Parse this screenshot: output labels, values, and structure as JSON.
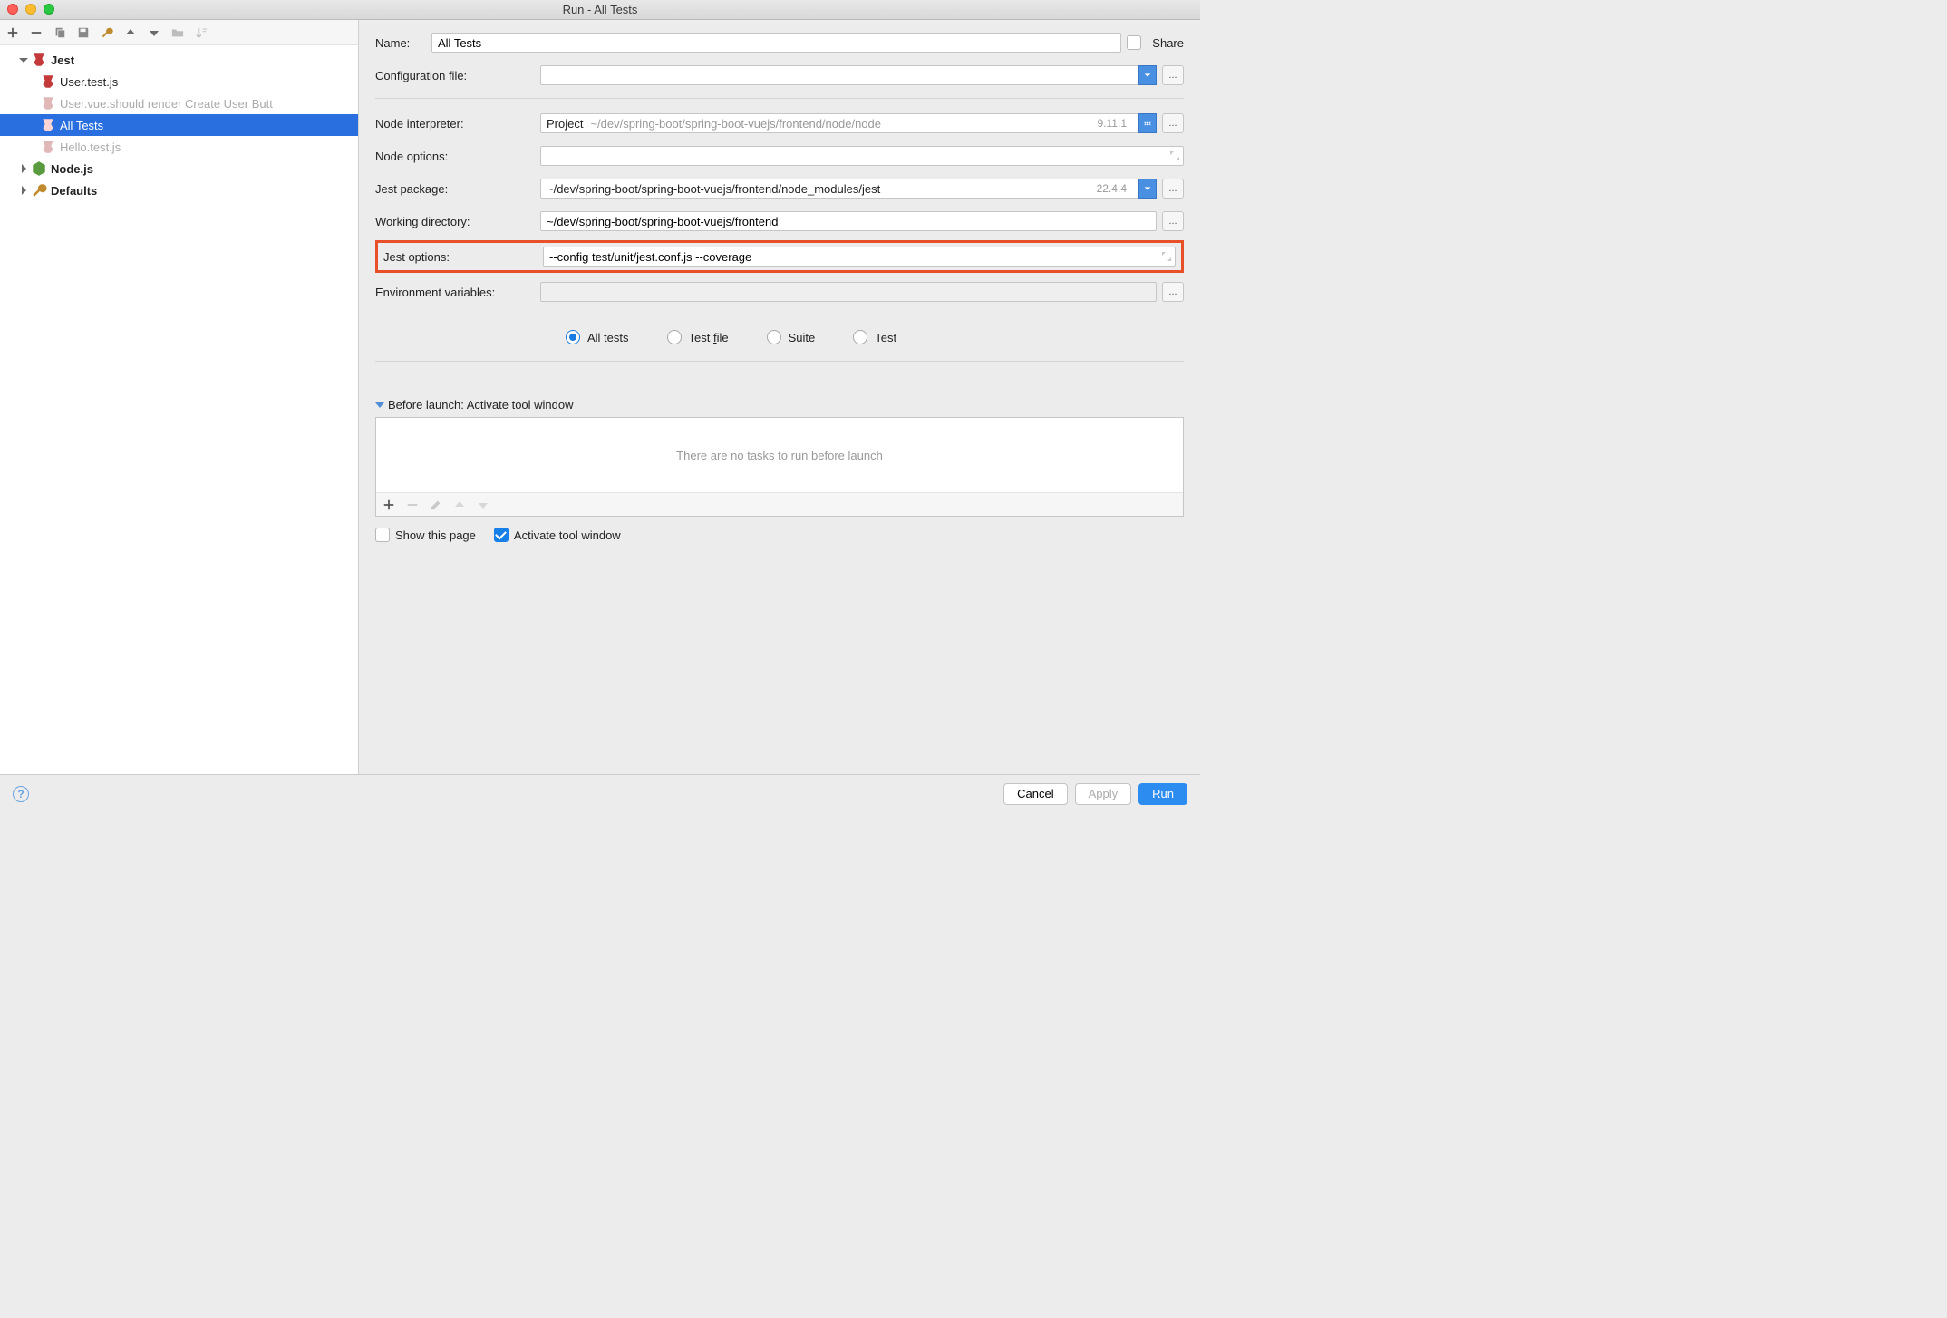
{
  "window": {
    "title": "Run - All Tests"
  },
  "sidebar": {
    "items": [
      {
        "label": "Jest"
      },
      {
        "label": "User.test.js"
      },
      {
        "label": "User.vue.should render Create User Butt"
      },
      {
        "label": "All Tests"
      },
      {
        "label": "Hello.test.js"
      },
      {
        "label": "Node.js"
      },
      {
        "label": "Defaults"
      }
    ]
  },
  "form": {
    "name_label": "Name:",
    "name_value": "All Tests",
    "share_label": "Share",
    "config_file_label": "Configuration file:",
    "config_file_value": "",
    "node_interpreter_label": "Node interpreter:",
    "node_interpreter_prefix": "Project",
    "node_interpreter_path": "~/dev/spring-boot/spring-boot-vuejs/frontend/node/node",
    "node_interpreter_ver": "9.11.1",
    "node_options_label": "Node options:",
    "node_options_value": "",
    "jest_package_label": "Jest package:",
    "jest_package_value": "~/dev/spring-boot/spring-boot-vuejs/frontend/node_modules/jest",
    "jest_package_ver": "22.4.4",
    "working_dir_label": "Working directory:",
    "working_dir_value": "~/dev/spring-boot/spring-boot-vuejs/frontend",
    "jest_options_label": "Jest options:",
    "jest_options_value": "--config test/unit/jest.conf.js --coverage",
    "env_label": "Environment variables:",
    "env_value": "",
    "radios": {
      "all_tests": "All tests",
      "test_file_pre": "Test ",
      "test_file_u": "f",
      "test_file_post": "ile",
      "suite": "Suite",
      "test": "Test"
    },
    "before_launch_label": "Before launch: Activate tool window",
    "before_launch_empty": "There are no tasks to run before launch",
    "show_this_page": "Show this page",
    "activate_tool_window": "Activate tool window"
  },
  "footer": {
    "cancel": "Cancel",
    "apply": "Apply",
    "run": "Run"
  }
}
